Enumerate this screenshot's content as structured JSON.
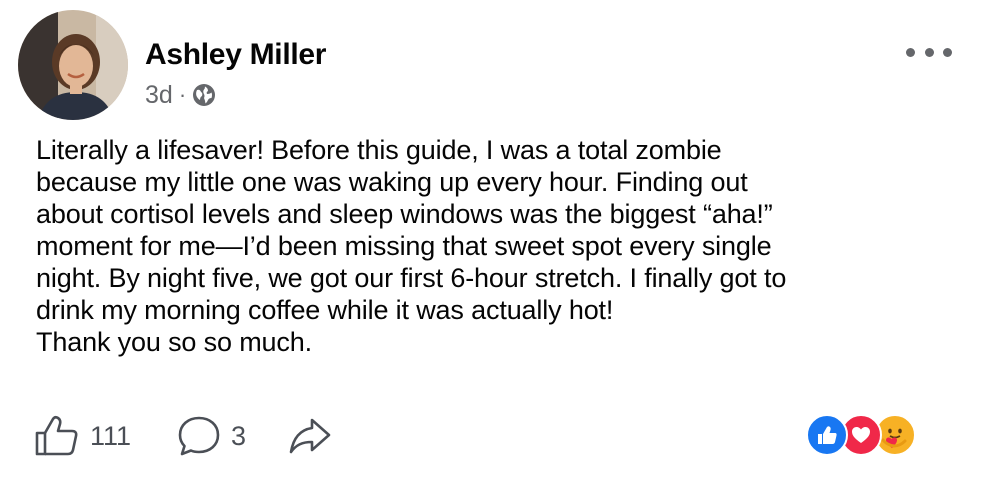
{
  "post": {
    "author": "Ashley Miller",
    "time": "3d",
    "separator": "·",
    "privacy_icon": "globe-icon",
    "more_icon": "ellipsis-icon",
    "body_lines": [
      "Literally a lifesaver! Before this guide, I was a total zombie",
      "because my little one was waking up every hour. Finding out",
      "about cortisol levels and sleep windows was the biggest “aha!”",
      "moment for me—I’d been missing that sweet spot every single",
      "night. By night five, we got our first 6-hour stretch. I finally got to",
      "drink my morning coffee while it was actually hot!",
      "Thank you so so much."
    ]
  },
  "actions": {
    "like_icon": "thumbs-up-icon",
    "like_count": "111",
    "comment_icon": "comment-bubble-icon",
    "comment_count": "3",
    "share_icon": "share-arrow-icon"
  },
  "reactions": {
    "items": [
      "like-reaction-icon",
      "love-reaction-icon",
      "care-reaction-icon"
    ],
    "colors": {
      "like": "#1877f2",
      "love": "#f02849",
      "care": "#f7b125"
    }
  },
  "colors": {
    "text": "#050505",
    "muted": "#65676b",
    "icon": "#4b4f56",
    "background": "#ffffff"
  }
}
